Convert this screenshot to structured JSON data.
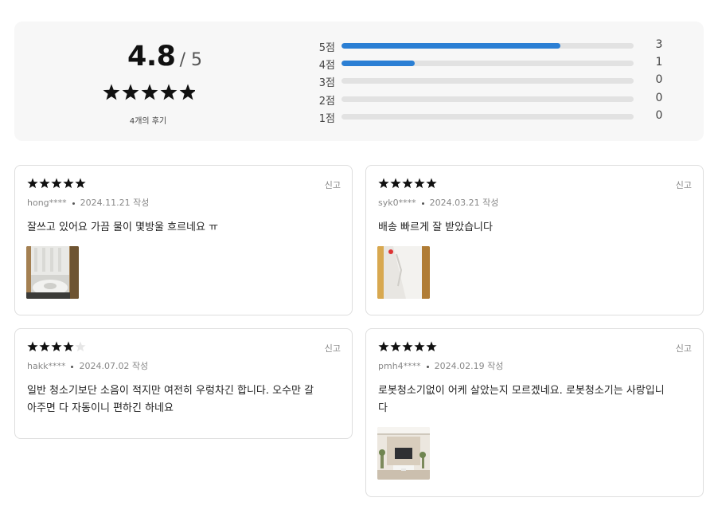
{
  "summary": {
    "average": "4.8",
    "out_of": "/ 5",
    "average_stars": 5,
    "review_count": "4개의 후기",
    "distribution": [
      {
        "label": "5점",
        "count": "3",
        "fraction": 0.75
      },
      {
        "label": "4점",
        "count": "1",
        "fraction": 0.25
      },
      {
        "label": "3점",
        "count": "0",
        "fraction": 0
      },
      {
        "label": "2점",
        "count": "0",
        "fraction": 0
      },
      {
        "label": "1점",
        "count": "0",
        "fraction": 0
      }
    ]
  },
  "report_label": "신고",
  "reviews": [
    {
      "stars": 5,
      "author": "hong****",
      "date": "2024.11.21 작성",
      "text": "잘쓰고 있어요 가끔 물이 몇방울 흐르네요 ㅠ",
      "has_photo": true
    },
    {
      "stars": 5,
      "author": "syk0****",
      "date": "2024.03.21 작성",
      "text": "배송 빠르게 잘 받았습니다",
      "has_photo": true
    },
    {
      "stars": 4,
      "author": "hakk****",
      "date": "2024.07.02 작성",
      "text": "일반 청소기보단 소음이 적지만 여전히 우렁차긴 합니다. 오수만 갈\n아주면 다 자동이니 편하긴 하네요",
      "has_photo": false
    },
    {
      "stars": 5,
      "author": "pmh4****",
      "date": "2024.02.19 작성",
      "text": "로봇청소기없이 어케 살았는지 모르겠네요. 로봇청소기는 사랑입니\n다",
      "has_photo": true
    }
  ],
  "colors": {
    "accent": "#2b7fd4",
    "star_filled": "#111111",
    "star_empty": "#e6e6e6"
  }
}
